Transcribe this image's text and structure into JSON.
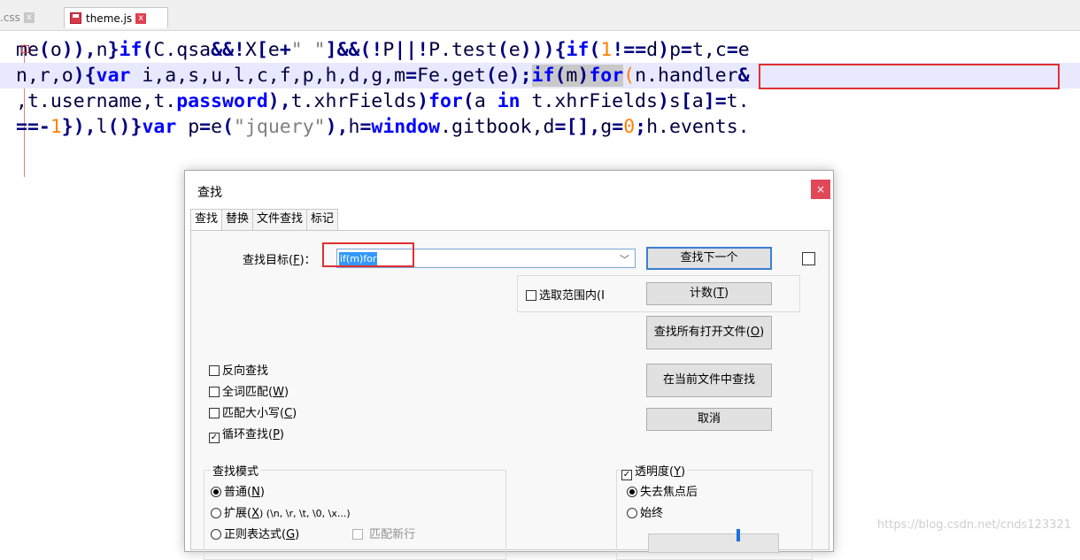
{
  "tabs": [
    {
      "label": ".css",
      "close": "x"
    },
    {
      "label": "theme.js",
      "close": "x"
    }
  ],
  "code_lines": [
    [
      {
        "t": "me",
        "c": "i"
      },
      {
        "t": "(",
        "c": "o"
      },
      {
        "t": "o",
        "c": "i"
      },
      {
        "t": ")),",
        "c": "o"
      },
      {
        "t": "n",
        "c": "i"
      },
      {
        "t": "}",
        "c": "o"
      },
      {
        "t": "if",
        "c": "k"
      },
      {
        "t": "(",
        "c": "o"
      },
      {
        "t": "C.qsa",
        "c": "i"
      },
      {
        "t": "&&!",
        "c": "o"
      },
      {
        "t": "X",
        "c": "i"
      },
      {
        "t": "[",
        "c": "o"
      },
      {
        "t": "e",
        "c": "i"
      },
      {
        "t": "+",
        "c": "o"
      },
      {
        "t": "\" \"",
        "c": "s"
      },
      {
        "t": "]&&(!",
        "c": "o"
      },
      {
        "t": "P",
        "c": "i"
      },
      {
        "t": "||!",
        "c": "o"
      },
      {
        "t": "P.test",
        "c": "i"
      },
      {
        "t": "(",
        "c": "o"
      },
      {
        "t": "e",
        "c": "i"
      },
      {
        "t": "))){",
        "c": "o"
      },
      {
        "t": "if",
        "c": "k"
      },
      {
        "t": "(",
        "c": "o"
      },
      {
        "t": "1",
        "c": "n"
      },
      {
        "t": "!==",
        "c": "o"
      },
      {
        "t": "d",
        "c": "i"
      },
      {
        "t": ")",
        "c": "o"
      },
      {
        "t": "p",
        "c": "i"
      },
      {
        "t": "=",
        "c": "o"
      },
      {
        "t": "t,c",
        "c": "i"
      },
      {
        "t": "=",
        "c": "o"
      },
      {
        "t": "e",
        "c": "i"
      }
    ],
    [
      {
        "t": "n,r,o",
        "c": "i"
      },
      {
        "t": "){",
        "c": "o"
      },
      {
        "t": "var",
        "c": "k"
      },
      {
        "t": " i,a,s,u,l,c,f,p,h,d,g,m",
        "c": "i"
      },
      {
        "t": "=",
        "c": "o"
      },
      {
        "t": "Fe.get",
        "c": "i"
      },
      {
        "t": "(",
        "c": "o"
      },
      {
        "t": "e",
        "c": "i"
      },
      {
        "t": ");",
        "c": "o"
      },
      {
        "t": "if",
        "c": "k",
        "m": true
      },
      {
        "t": "(",
        "c": "o",
        "m": true
      },
      {
        "t": "m",
        "c": "i",
        "m": true
      },
      {
        "t": ")",
        "c": "o",
        "m": true
      },
      {
        "t": "for",
        "c": "k",
        "m": true
      },
      {
        "t": "(",
        "c": "n"
      },
      {
        "t": "n.handler",
        "c": "i"
      },
      {
        "t": "&",
        "c": "o"
      }
    ],
    [
      {
        "t": ",t.username,t.",
        "c": "i"
      },
      {
        "t": "password",
        "c": "k2"
      },
      {
        "t": "),",
        "c": "o"
      },
      {
        "t": "t.xhrFields",
        "c": "i"
      },
      {
        "t": ")",
        "c": "o"
      },
      {
        "t": "for",
        "c": "k"
      },
      {
        "t": "(",
        "c": "o"
      },
      {
        "t": "a ",
        "c": "i"
      },
      {
        "t": "in",
        "c": "k"
      },
      {
        "t": " t.xhrFields",
        "c": "i"
      },
      {
        "t": ")",
        "c": "o"
      },
      {
        "t": "s",
        "c": "i"
      },
      {
        "t": "[",
        "c": "o"
      },
      {
        "t": "a",
        "c": "i"
      },
      {
        "t": "]=",
        "c": "o"
      },
      {
        "t": "t.",
        "c": "i"
      }
    ],
    [
      {
        "t": "==-",
        "c": "o"
      },
      {
        "t": "1",
        "c": "n"
      },
      {
        "t": "}),",
        "c": "o"
      },
      {
        "t": "l",
        "c": "i"
      },
      {
        "t": "()}",
        "c": "o"
      },
      {
        "t": "var",
        "c": "k"
      },
      {
        "t": " p",
        "c": "i"
      },
      {
        "t": "=",
        "c": "o"
      },
      {
        "t": "e",
        "c": "i"
      },
      {
        "t": "(",
        "c": "o"
      },
      {
        "t": "\"jquery\"",
        "c": "s"
      },
      {
        "t": "),",
        "c": "o"
      },
      {
        "t": "h",
        "c": "i"
      },
      {
        "t": "=",
        "c": "o"
      },
      {
        "t": "window",
        "c": "k"
      },
      {
        "t": ".gitbook,d",
        "c": "i"
      },
      {
        "t": "=[],",
        "c": "o"
      },
      {
        "t": "g",
        "c": "i"
      },
      {
        "t": "=",
        "c": "o"
      },
      {
        "t": "0",
        "c": "n"
      },
      {
        "t": ";",
        "c": "o"
      },
      {
        "t": "h.events.",
        "c": "i"
      }
    ]
  ],
  "dialog": {
    "title": "查找",
    "close": "×",
    "tabs": [
      "查找",
      "替换",
      "文件查找",
      "标记"
    ],
    "find_label": "查找目标(",
    "find_label_key": "F",
    "find_label_end": ")：",
    "find_value": "if(m)for",
    "in_selection": "选取范围内(I",
    "buttons": {
      "find_next": "查找下一个",
      "count": "计数(",
      "count_key": "T",
      "find_all_open": "查找所有打开文件(",
      "find_all_open_key": "O",
      "find_in_current": "在当前文件中查找",
      "cancel": "取消"
    },
    "options": {
      "backward": "反向查找",
      "whole_word": "全词匹配(",
      "whole_word_key": "W",
      "match_case": "匹配大小写(",
      "match_case_key": "C",
      "wrap": "循环查找(",
      "wrap_key": "P"
    },
    "search_mode": {
      "title": "查找模式",
      "normal": "普通(",
      "normal_key": "N",
      "extended": "扩展(",
      "extended_key": "X",
      "extended_hint": ") (\\n, \\r, \\t, \\0, \\x...)",
      "regex": "正则表达式(",
      "regex_key": "G",
      "newline": "匹配新行"
    },
    "transparency": {
      "label": "透明度(",
      "label_key": "Y",
      "on_lose_focus": "失去焦点后",
      "always": "始终",
      "level": 0.7
    }
  },
  "watermark": "https://blog.csdn.net/cnds123321"
}
